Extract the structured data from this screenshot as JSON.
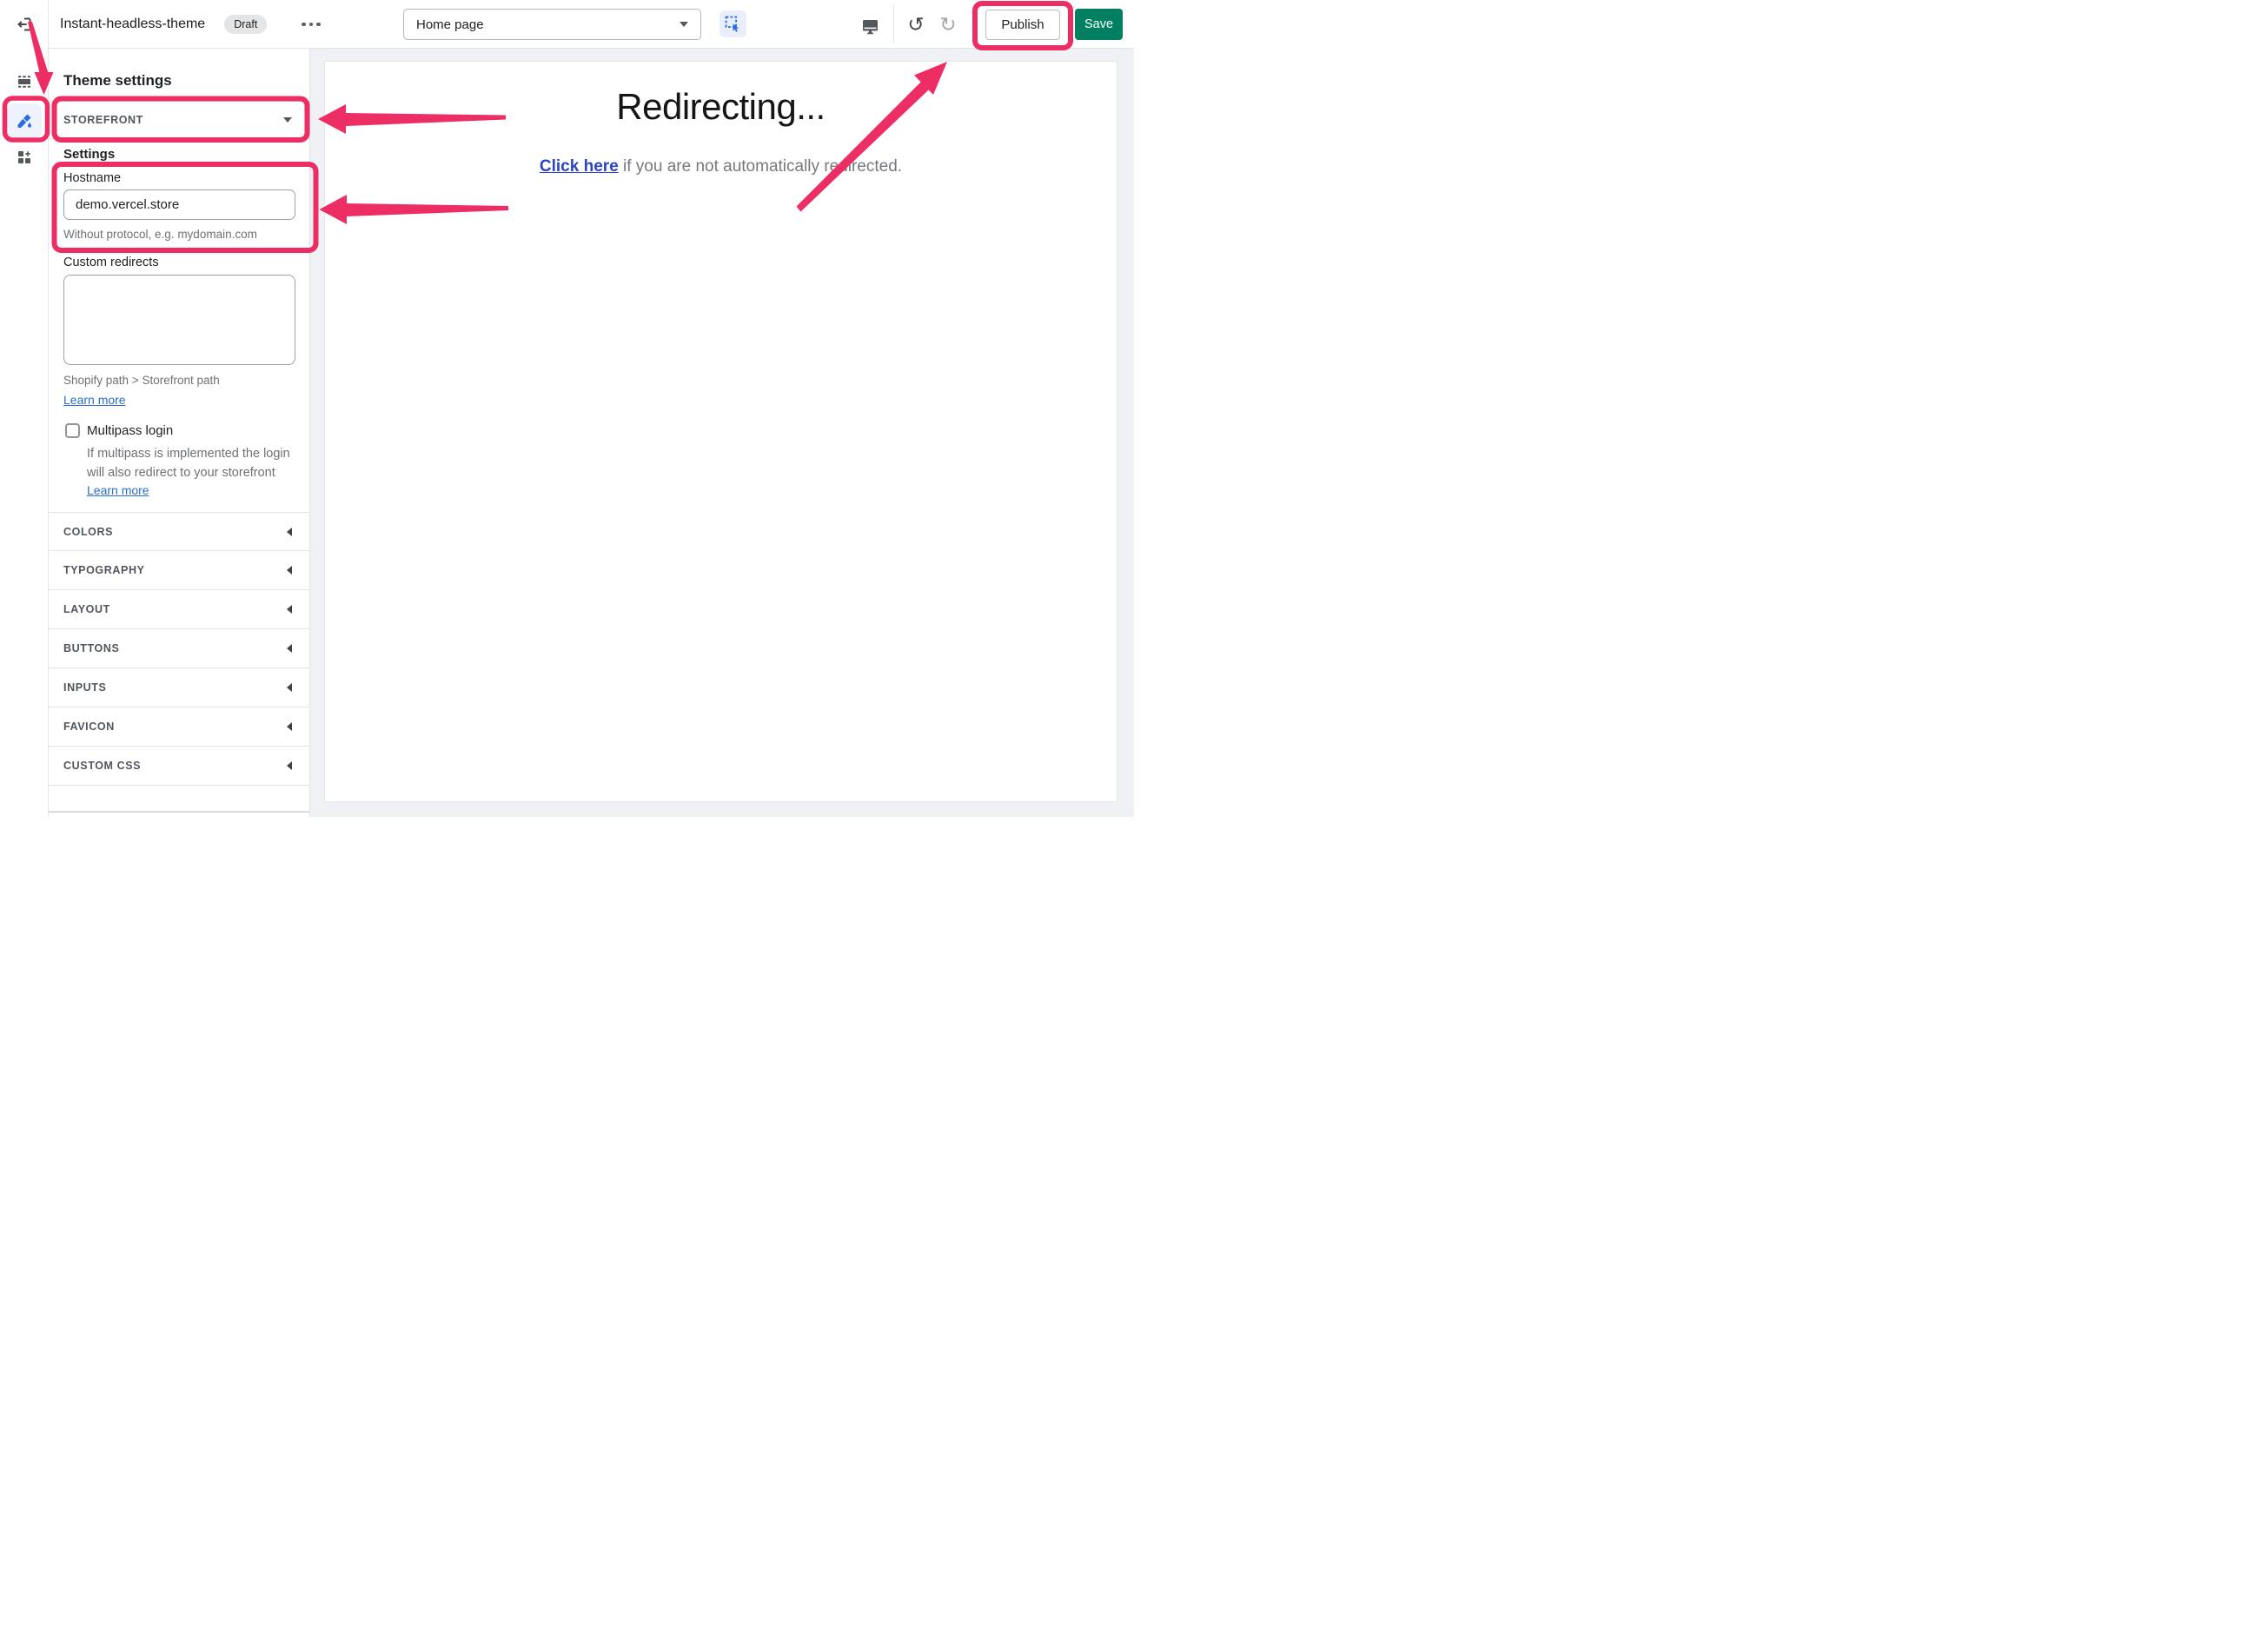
{
  "topbar": {
    "theme_name": "Instant-headless-theme",
    "status_badge": "Draft",
    "page_selector": {
      "value": "Home page"
    },
    "publish_label": "Publish",
    "save_label": "Save"
  },
  "rail": {
    "items": [
      "sections",
      "theme-settings",
      "apps"
    ],
    "active_item": "theme-settings"
  },
  "sidebar": {
    "title": "Theme settings",
    "group_header": "STOREFRONT",
    "settings_heading": "Settings",
    "hostname": {
      "label": "Hostname",
      "value": "demo.vercel.store",
      "helper": "Without protocol, e.g. mydomain.com"
    },
    "custom_redirects": {
      "label": "Custom redirects",
      "value": "",
      "helper": "Shopify path > Storefront path",
      "link": "Learn more"
    },
    "multipass": {
      "label": "Multipass login",
      "checked": false,
      "description_lines": [
        "If multipass is implemented the login",
        "will also redirect to your storefront"
      ],
      "link": "Learn more"
    },
    "collapsed_sections": [
      "COLORS",
      "TYPOGRAPHY",
      "LAYOUT",
      "BUTTONS",
      "INPUTS",
      "FAVICON",
      "CUSTOM CSS"
    ]
  },
  "preview": {
    "heading": "Redirecting...",
    "link_text": "Click here",
    "body_text": " if you are not automatically redirected."
  },
  "colors": {
    "annotation_pink": "#ED2E64",
    "save_green": "#008060",
    "accent_blue": "#2C6CE3",
    "sidebar_link_blue": "#2C6ECB",
    "preview_link_blue": "#2B44C7"
  }
}
